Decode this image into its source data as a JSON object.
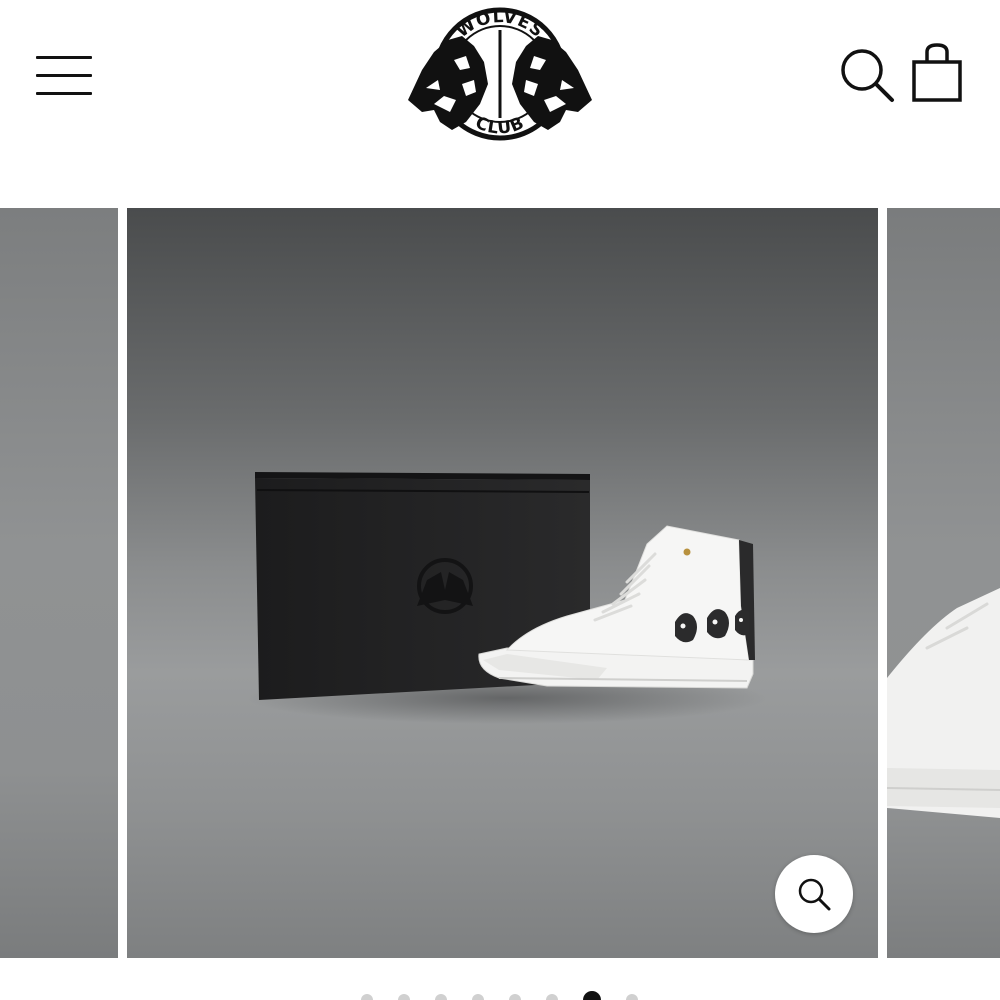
{
  "header": {
    "logo_top_text": "WOLVES",
    "logo_bottom_text": "CLUB",
    "menu_icon": "hamburger-menu-icon",
    "search_icon": "search-icon",
    "cart_icon": "shopping-bag-icon"
  },
  "gallery": {
    "zoom_icon": "zoom-icon",
    "dot_count": 8,
    "active_dot": 7
  }
}
